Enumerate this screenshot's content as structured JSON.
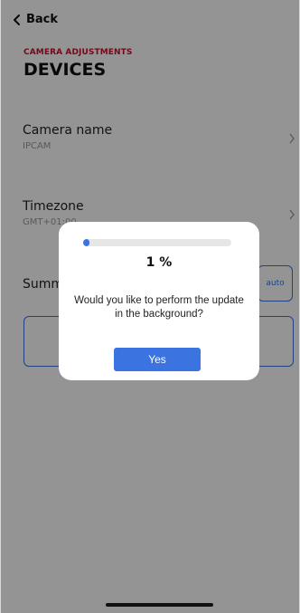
{
  "nav": {
    "back_label": "Back"
  },
  "header": {
    "section_label": "CAMERA ADJUSTMENTS",
    "title": "DEVICES"
  },
  "settings": {
    "camera_name": {
      "label": "Camera name",
      "value": "IPCAM"
    },
    "timezone": {
      "label": "Timezone",
      "value": "GMT+01:00"
    },
    "summary_label": "Summ",
    "auto_label": "auto"
  },
  "dialog": {
    "progress": 1,
    "progress_label": "1 %",
    "message": "Would you like to perform the update in the background?",
    "yes_label": "Yes"
  },
  "colors": {
    "accent": "#3b73e0",
    "brand_red": "#c8102e",
    "overlay": "rgba(0,0,0,0.42)"
  }
}
